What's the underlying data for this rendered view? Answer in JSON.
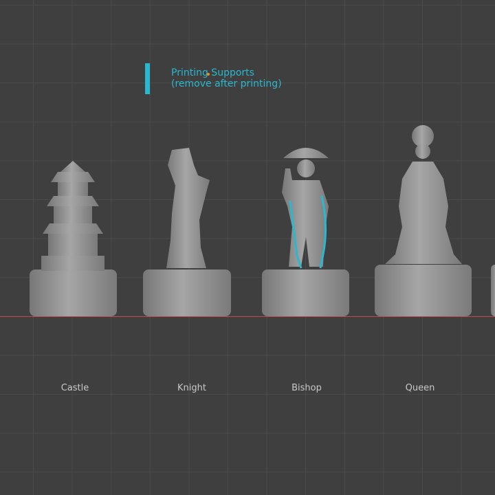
{
  "annotation": {
    "line1": "Printing Supports",
    "line2": "(remove after printing)",
    "color": "#2ab8cf"
  },
  "pieces": [
    {
      "label": "Castle"
    },
    {
      "label": "Knight"
    },
    {
      "label": "Bishop"
    },
    {
      "label": "Queen"
    }
  ],
  "colors": {
    "background": "#3f3f3f",
    "grid": "#4b4b4b",
    "ground_axis": "#c8444f",
    "model": "#8e8e8e"
  }
}
